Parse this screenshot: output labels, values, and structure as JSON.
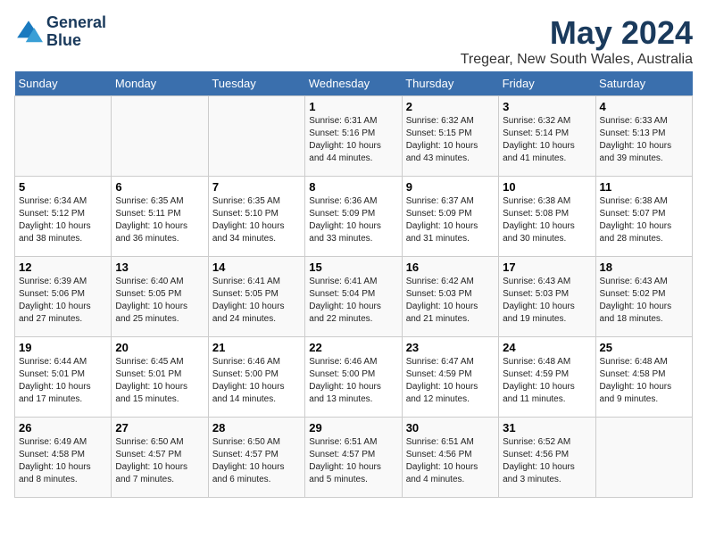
{
  "logo": {
    "line1": "General",
    "line2": "Blue"
  },
  "title": "May 2024",
  "location": "Tregear, New South Wales, Australia",
  "days_of_week": [
    "Sunday",
    "Monday",
    "Tuesday",
    "Wednesday",
    "Thursday",
    "Friday",
    "Saturday"
  ],
  "weeks": [
    [
      {
        "num": "",
        "info": ""
      },
      {
        "num": "",
        "info": ""
      },
      {
        "num": "",
        "info": ""
      },
      {
        "num": "1",
        "info": "Sunrise: 6:31 AM\nSunset: 5:16 PM\nDaylight: 10 hours\nand 44 minutes."
      },
      {
        "num": "2",
        "info": "Sunrise: 6:32 AM\nSunset: 5:15 PM\nDaylight: 10 hours\nand 43 minutes."
      },
      {
        "num": "3",
        "info": "Sunrise: 6:32 AM\nSunset: 5:14 PM\nDaylight: 10 hours\nand 41 minutes."
      },
      {
        "num": "4",
        "info": "Sunrise: 6:33 AM\nSunset: 5:13 PM\nDaylight: 10 hours\nand 39 minutes."
      }
    ],
    [
      {
        "num": "5",
        "info": "Sunrise: 6:34 AM\nSunset: 5:12 PM\nDaylight: 10 hours\nand 38 minutes."
      },
      {
        "num": "6",
        "info": "Sunrise: 6:35 AM\nSunset: 5:11 PM\nDaylight: 10 hours\nand 36 minutes."
      },
      {
        "num": "7",
        "info": "Sunrise: 6:35 AM\nSunset: 5:10 PM\nDaylight: 10 hours\nand 34 minutes."
      },
      {
        "num": "8",
        "info": "Sunrise: 6:36 AM\nSunset: 5:09 PM\nDaylight: 10 hours\nand 33 minutes."
      },
      {
        "num": "9",
        "info": "Sunrise: 6:37 AM\nSunset: 5:09 PM\nDaylight: 10 hours\nand 31 minutes."
      },
      {
        "num": "10",
        "info": "Sunrise: 6:38 AM\nSunset: 5:08 PM\nDaylight: 10 hours\nand 30 minutes."
      },
      {
        "num": "11",
        "info": "Sunrise: 6:38 AM\nSunset: 5:07 PM\nDaylight: 10 hours\nand 28 minutes."
      }
    ],
    [
      {
        "num": "12",
        "info": "Sunrise: 6:39 AM\nSunset: 5:06 PM\nDaylight: 10 hours\nand 27 minutes."
      },
      {
        "num": "13",
        "info": "Sunrise: 6:40 AM\nSunset: 5:05 PM\nDaylight: 10 hours\nand 25 minutes."
      },
      {
        "num": "14",
        "info": "Sunrise: 6:41 AM\nSunset: 5:05 PM\nDaylight: 10 hours\nand 24 minutes."
      },
      {
        "num": "15",
        "info": "Sunrise: 6:41 AM\nSunset: 5:04 PM\nDaylight: 10 hours\nand 22 minutes."
      },
      {
        "num": "16",
        "info": "Sunrise: 6:42 AM\nSunset: 5:03 PM\nDaylight: 10 hours\nand 21 minutes."
      },
      {
        "num": "17",
        "info": "Sunrise: 6:43 AM\nSunset: 5:03 PM\nDaylight: 10 hours\nand 19 minutes."
      },
      {
        "num": "18",
        "info": "Sunrise: 6:43 AM\nSunset: 5:02 PM\nDaylight: 10 hours\nand 18 minutes."
      }
    ],
    [
      {
        "num": "19",
        "info": "Sunrise: 6:44 AM\nSunset: 5:01 PM\nDaylight: 10 hours\nand 17 minutes."
      },
      {
        "num": "20",
        "info": "Sunrise: 6:45 AM\nSunset: 5:01 PM\nDaylight: 10 hours\nand 15 minutes."
      },
      {
        "num": "21",
        "info": "Sunrise: 6:46 AM\nSunset: 5:00 PM\nDaylight: 10 hours\nand 14 minutes."
      },
      {
        "num": "22",
        "info": "Sunrise: 6:46 AM\nSunset: 5:00 PM\nDaylight: 10 hours\nand 13 minutes."
      },
      {
        "num": "23",
        "info": "Sunrise: 6:47 AM\nSunset: 4:59 PM\nDaylight: 10 hours\nand 12 minutes."
      },
      {
        "num": "24",
        "info": "Sunrise: 6:48 AM\nSunset: 4:59 PM\nDaylight: 10 hours\nand 11 minutes."
      },
      {
        "num": "25",
        "info": "Sunrise: 6:48 AM\nSunset: 4:58 PM\nDaylight: 10 hours\nand 9 minutes."
      }
    ],
    [
      {
        "num": "26",
        "info": "Sunrise: 6:49 AM\nSunset: 4:58 PM\nDaylight: 10 hours\nand 8 minutes."
      },
      {
        "num": "27",
        "info": "Sunrise: 6:50 AM\nSunset: 4:57 PM\nDaylight: 10 hours\nand 7 minutes."
      },
      {
        "num": "28",
        "info": "Sunrise: 6:50 AM\nSunset: 4:57 PM\nDaylight: 10 hours\nand 6 minutes."
      },
      {
        "num": "29",
        "info": "Sunrise: 6:51 AM\nSunset: 4:57 PM\nDaylight: 10 hours\nand 5 minutes."
      },
      {
        "num": "30",
        "info": "Sunrise: 6:51 AM\nSunset: 4:56 PM\nDaylight: 10 hours\nand 4 minutes."
      },
      {
        "num": "31",
        "info": "Sunrise: 6:52 AM\nSunset: 4:56 PM\nDaylight: 10 hours\nand 3 minutes."
      },
      {
        "num": "",
        "info": ""
      }
    ]
  ]
}
